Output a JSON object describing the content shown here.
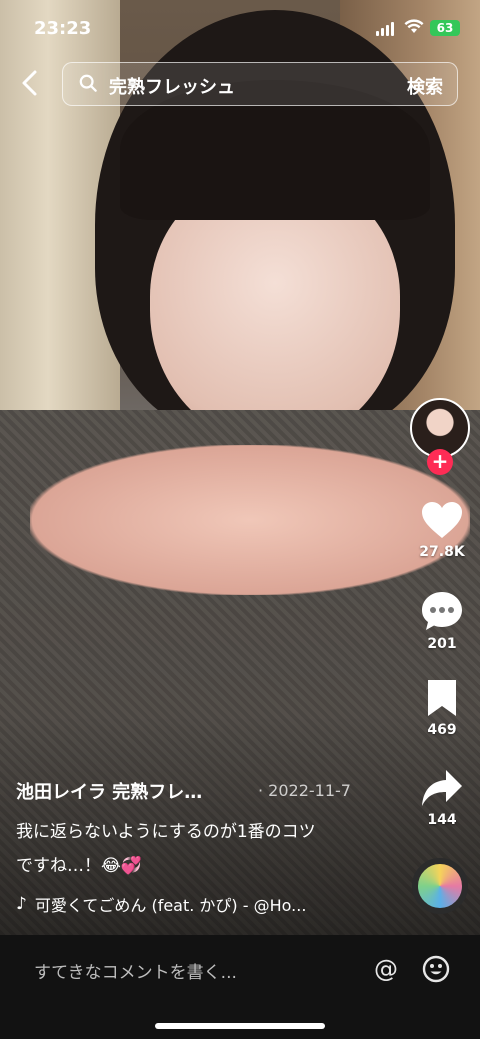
{
  "status_bar": {
    "time": "23:23",
    "battery": "63"
  },
  "search": {
    "query": "完熟フレッシュ",
    "button_label": "検索"
  },
  "actions": {
    "likes": "27.8K",
    "comments": "201",
    "saves": "469",
    "shares": "144"
  },
  "post": {
    "author": "池田レイラ 完熟フレ…",
    "date": "· 2022-11-7",
    "caption_line1": "我に返らないようにするのが1番のコツ",
    "caption_line2": "ですね…！😂💞",
    "music": "可愛くてごめん (feat. かぴ) - @Ho..."
  },
  "comment_bar": {
    "placeholder": "すてきなコメントを書く...",
    "mention_symbol": "@"
  },
  "colors": {
    "follow": "#fe2c55",
    "battery": "#34c759",
    "comment_bar_bg": "#121212"
  },
  "icons": [
    "back-arrow-icon",
    "search-icon",
    "heart-icon",
    "comment-bubble-icon",
    "bookmark-icon",
    "share-arrow-icon",
    "music-note-icon",
    "at-icon",
    "emoji-icon"
  ]
}
